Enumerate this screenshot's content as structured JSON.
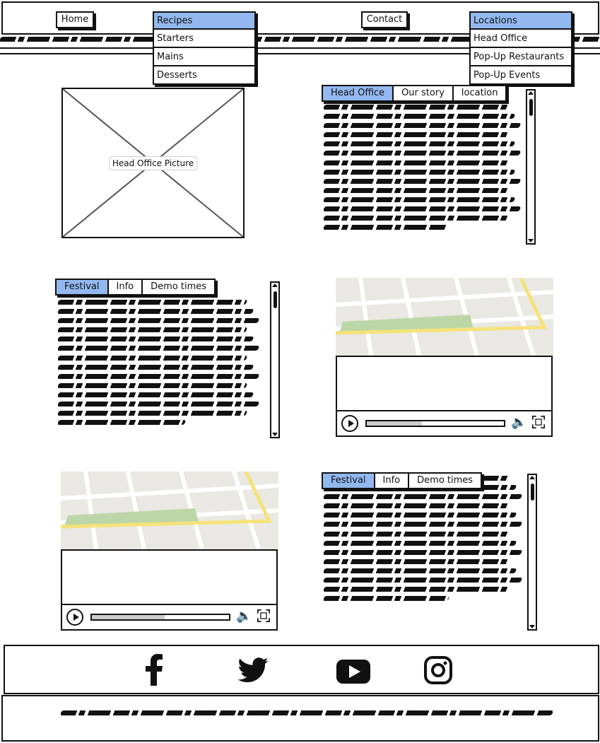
{
  "nav": {
    "home_label": "Home",
    "contact_label": "Contact",
    "ellipsis": "...",
    "recipes": {
      "label": "Recipes",
      "items": [
        "Starters",
        "Mains",
        "Desserts"
      ]
    },
    "locations": {
      "label": "Locations",
      "items": [
        "Head Office",
        "Pop-Up Restaurants",
        "Pop-Up Events"
      ]
    }
  },
  "head_office": {
    "image_label": "Head Office Picture",
    "tabs": [
      "Head Office",
      "Our story",
      "location"
    ],
    "active_tab": 0
  },
  "festival_top": {
    "tabs": [
      "Festival",
      "Info",
      "Demo times"
    ],
    "active_tab": 0
  },
  "festival_bottom": {
    "tabs": [
      "Festival",
      "Info",
      "Demo times"
    ],
    "active_tab": 0
  },
  "video_top": {
    "progress": 0.4
  },
  "video_bottom": {
    "progress": 0.53
  },
  "social": {
    "icons": [
      "facebook-icon",
      "twitter-icon",
      "youtube-icon",
      "instagram-icon"
    ]
  },
  "colors": {
    "accent": "#93b8f0",
    "map_bg": "#e9e8e2",
    "map_park": "#bcd6a8",
    "map_road_major": "#f5e27a"
  }
}
